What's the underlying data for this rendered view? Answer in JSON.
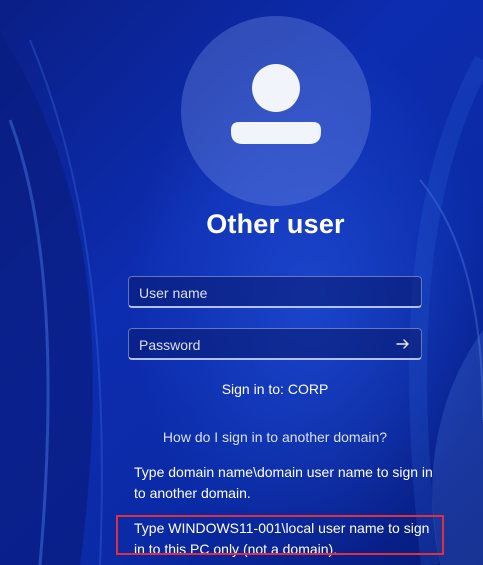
{
  "colors": {
    "background": "#0b2a9e",
    "highlight_border": "#e0303f",
    "text": "#ffffff"
  },
  "user": {
    "title": "Other user",
    "avatar_icon": "person-icon"
  },
  "form": {
    "username_placeholder": "User name",
    "password_placeholder": "Password",
    "submit_icon": "arrow-right-icon"
  },
  "signin_target": "Sign in to: CORP",
  "help_link": "How do I sign in to another domain?",
  "tips": {
    "domain": "Type domain name\\domain user name to sign in to another domain.",
    "local": "Type WINDOWS11-001\\local user name to sign in to this PC only (not a domain)."
  }
}
